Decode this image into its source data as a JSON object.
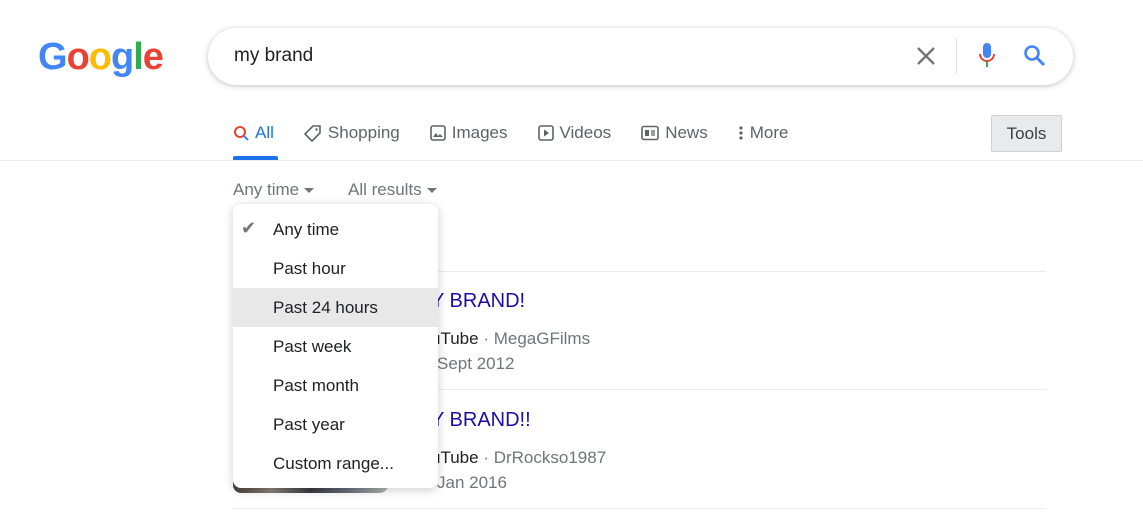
{
  "logo": "Google",
  "search": {
    "query": "my brand"
  },
  "tabs": [
    {
      "label": "All",
      "icon": "search-icon"
    },
    {
      "label": "Shopping",
      "icon": "tag-icon"
    },
    {
      "label": "Images",
      "icon": "image-icon"
    },
    {
      "label": "Videos",
      "icon": "play-icon"
    },
    {
      "label": "News",
      "icon": "news-icon"
    },
    {
      "label": "More",
      "icon": "more-vert-icon"
    }
  ],
  "tools_label": "Tools",
  "filters": {
    "time": "Any time",
    "results": "All results"
  },
  "time_menu": {
    "selected": "Any time",
    "hovered": "Past 24 hours",
    "items": [
      "Any time",
      "Past hour",
      "Past 24 hours",
      "Past week",
      "Past month",
      "Past year",
      "Custom range..."
    ]
  },
  "results": [
    {
      "title": "Y BRAND!",
      "source": "uTube",
      "channel": "MegaGFilms",
      "date": "Sept 2012"
    },
    {
      "title": "Y BRAND!!",
      "source": "uTube",
      "channel": "DrRockso1987",
      "date": "Jan 2016"
    }
  ],
  "colors": {
    "accent": "#1a73e8",
    "link": "#1a0dab"
  }
}
